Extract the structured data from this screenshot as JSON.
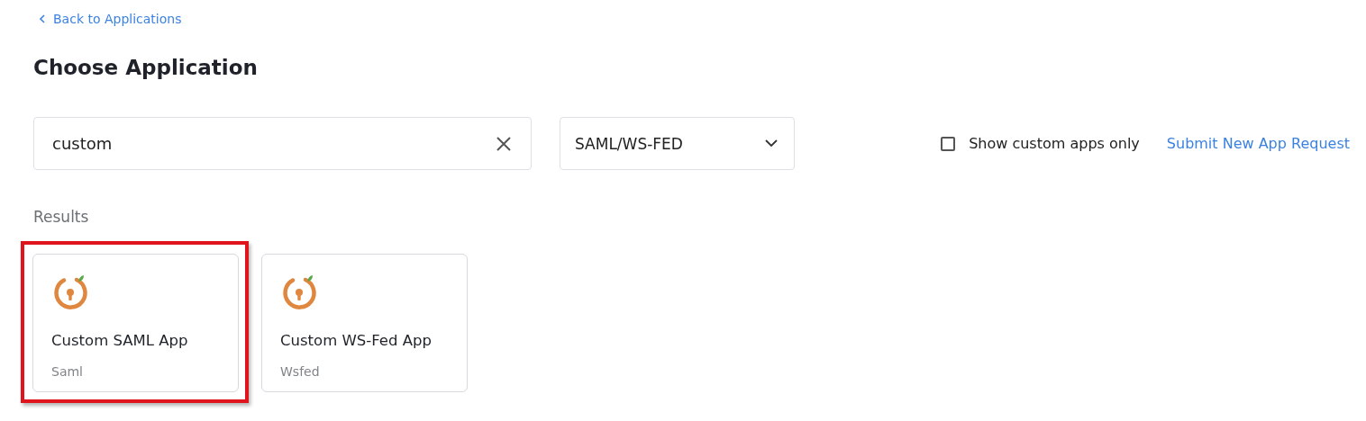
{
  "back_link": "Back to Applications",
  "title": "Choose Application",
  "search": {
    "value": "custom"
  },
  "protocol_select": {
    "value": "SAML/WS-FED"
  },
  "custom_only": {
    "label": "Show custom apps only",
    "checked": false
  },
  "submit_link": "Submit New App Request",
  "results_heading": "Results",
  "results": [
    {
      "name": "Custom SAML App",
      "type": "Saml",
      "highlighted": true
    },
    {
      "name": "Custom WS-Fed App",
      "type": "Wsfed",
      "highlighted": false
    }
  ]
}
